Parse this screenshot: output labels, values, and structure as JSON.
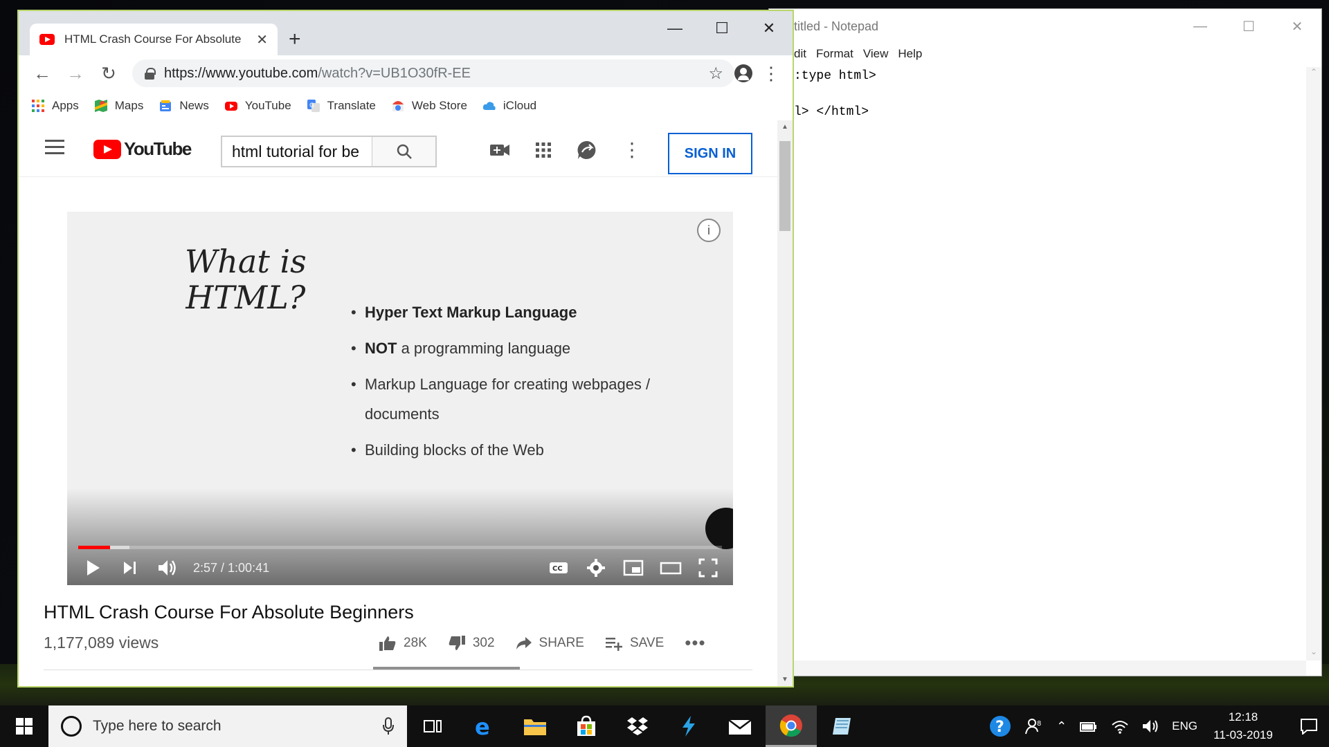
{
  "notepad": {
    "title": "titled - Notepad",
    "menu": [
      "dit",
      "Format",
      "View",
      "Help"
    ],
    "content": ":type html>\n\nl> </html>"
  },
  "browser": {
    "tab_title": "HTML Crash Course For Absolute",
    "url_host": "https://www.youtube.com",
    "url_path": "/watch?v=UB1O30fR-EE",
    "bookmarks": [
      {
        "label": "Apps",
        "icon": "apps-grid-icon"
      },
      {
        "label": "Maps",
        "icon": "maps-icon"
      },
      {
        "label": "News",
        "icon": "news-icon"
      },
      {
        "label": "YouTube",
        "icon": "youtube-icon"
      },
      {
        "label": "Translate",
        "icon": "translate-icon"
      },
      {
        "label": "Web Store",
        "icon": "web-store-icon"
      },
      {
        "label": "iCloud",
        "icon": "icloud-icon"
      }
    ]
  },
  "youtube": {
    "logo_text": "YouTube",
    "search_value": "html tutorial for be",
    "sign_in": "SIGN IN",
    "slide": {
      "title_line1": "What is",
      "title_line2": "HTML?",
      "b1_bold": "Hyper Text Markup Language",
      "b2_bold": "NOT",
      "b2_rest": " a programming language",
      "b3": "Markup Language for creating webpages /",
      "b3b": "documents",
      "b4": "Building blocks of the Web"
    },
    "player": {
      "time": "2:57 / 1:00:41",
      "progress_played": 0.049,
      "progress_buffered": 0.08
    },
    "video_title": "HTML Crash Course For Absolute Beginners",
    "views": "1,177,089 views",
    "likes": "28K",
    "dislikes": "302",
    "share": "SHARE",
    "save": "SAVE"
  },
  "taskbar": {
    "search_placeholder": "Type here to search",
    "lang": "ENG",
    "time": "12:18",
    "date": "11-03-2019"
  },
  "colors": {
    "yt_red": "#ff0000",
    "signin_blue": "#065fd4",
    "chrome_border": "#b9d66a"
  }
}
